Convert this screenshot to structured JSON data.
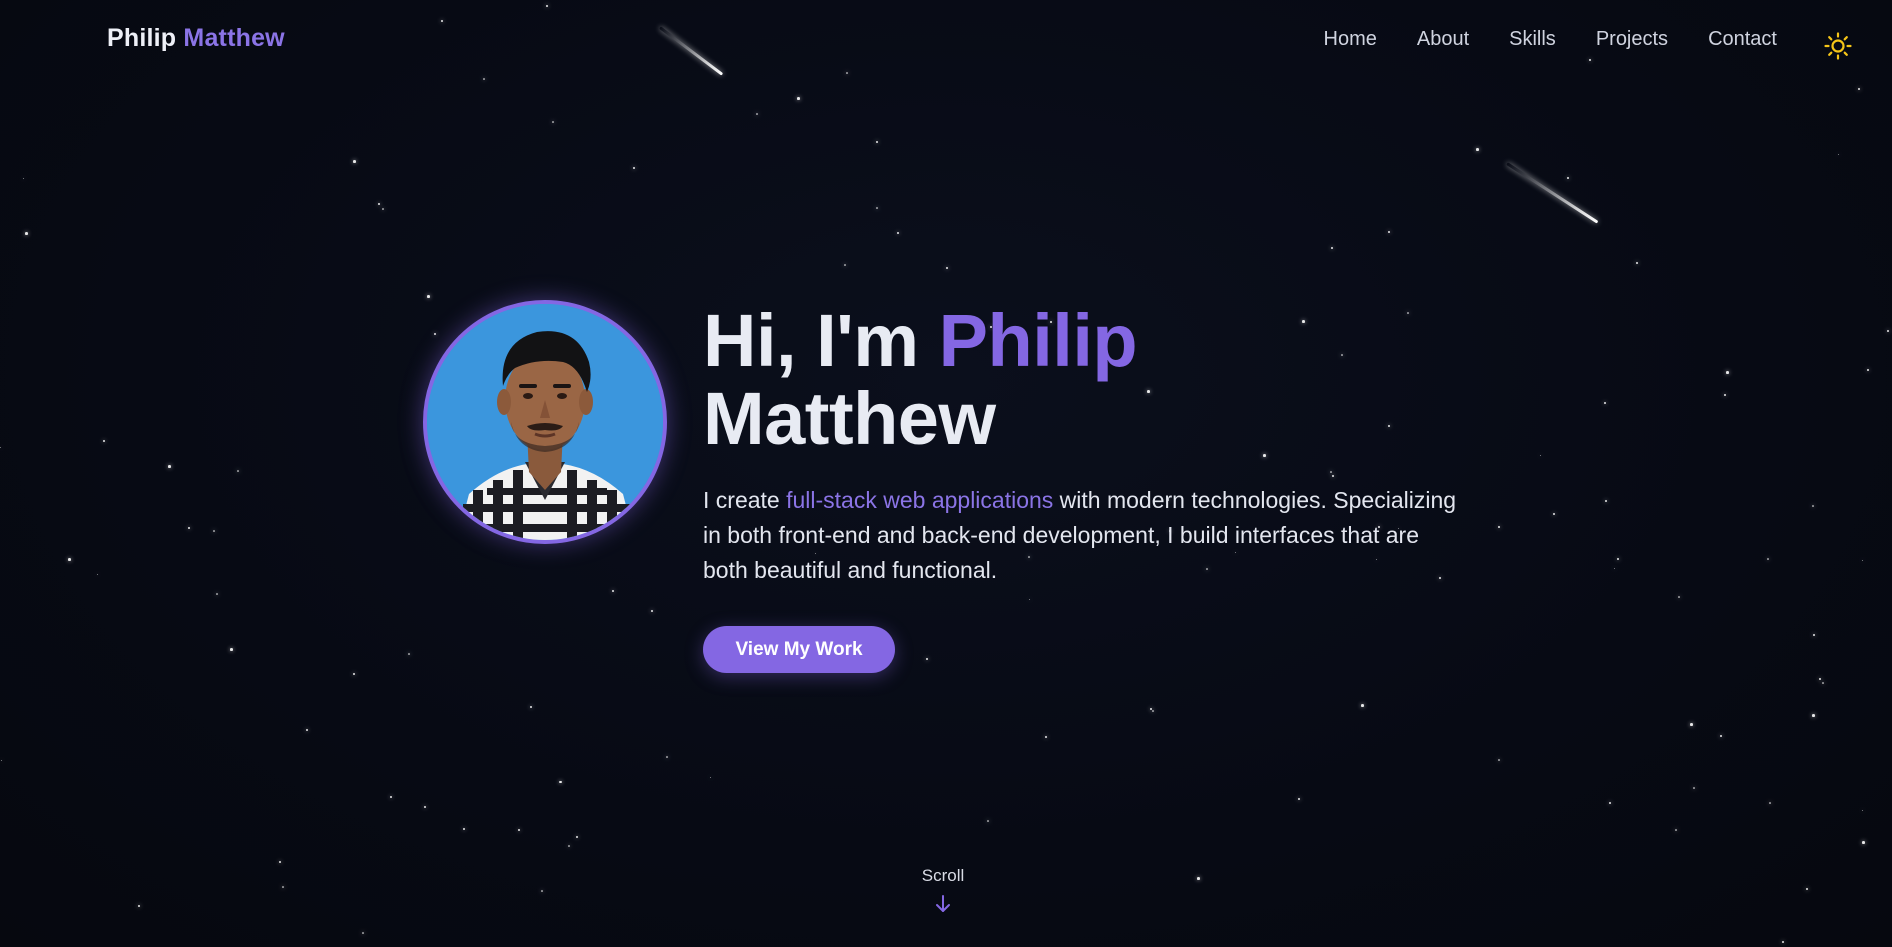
{
  "brand": {
    "first_name": "Philip",
    "last_name": "Matthew"
  },
  "nav": {
    "items": [
      "Home",
      "About",
      "Skills",
      "Projects",
      "Contact"
    ],
    "theme_toggle_icon": "sun-icon"
  },
  "hero": {
    "greeting": "Hi, I'm ",
    "name_accent": "Philip",
    "name_rest": "Matthew",
    "desc_prefix": "I create ",
    "desc_accent": "full-stack web applications",
    "desc_suffix": " with modern technologies. Specializing in both front-end and back-end development, I build interfaces that are both beautiful and functional.",
    "cta_label": "View My Work",
    "avatar_icon": "profile-photo"
  },
  "scroll": {
    "label": "Scroll",
    "icon": "arrow-down-icon"
  },
  "colors": {
    "background": "#070a14",
    "accent": "#8467e3",
    "text": "#e8ebf3",
    "sun": "#f5c518"
  }
}
